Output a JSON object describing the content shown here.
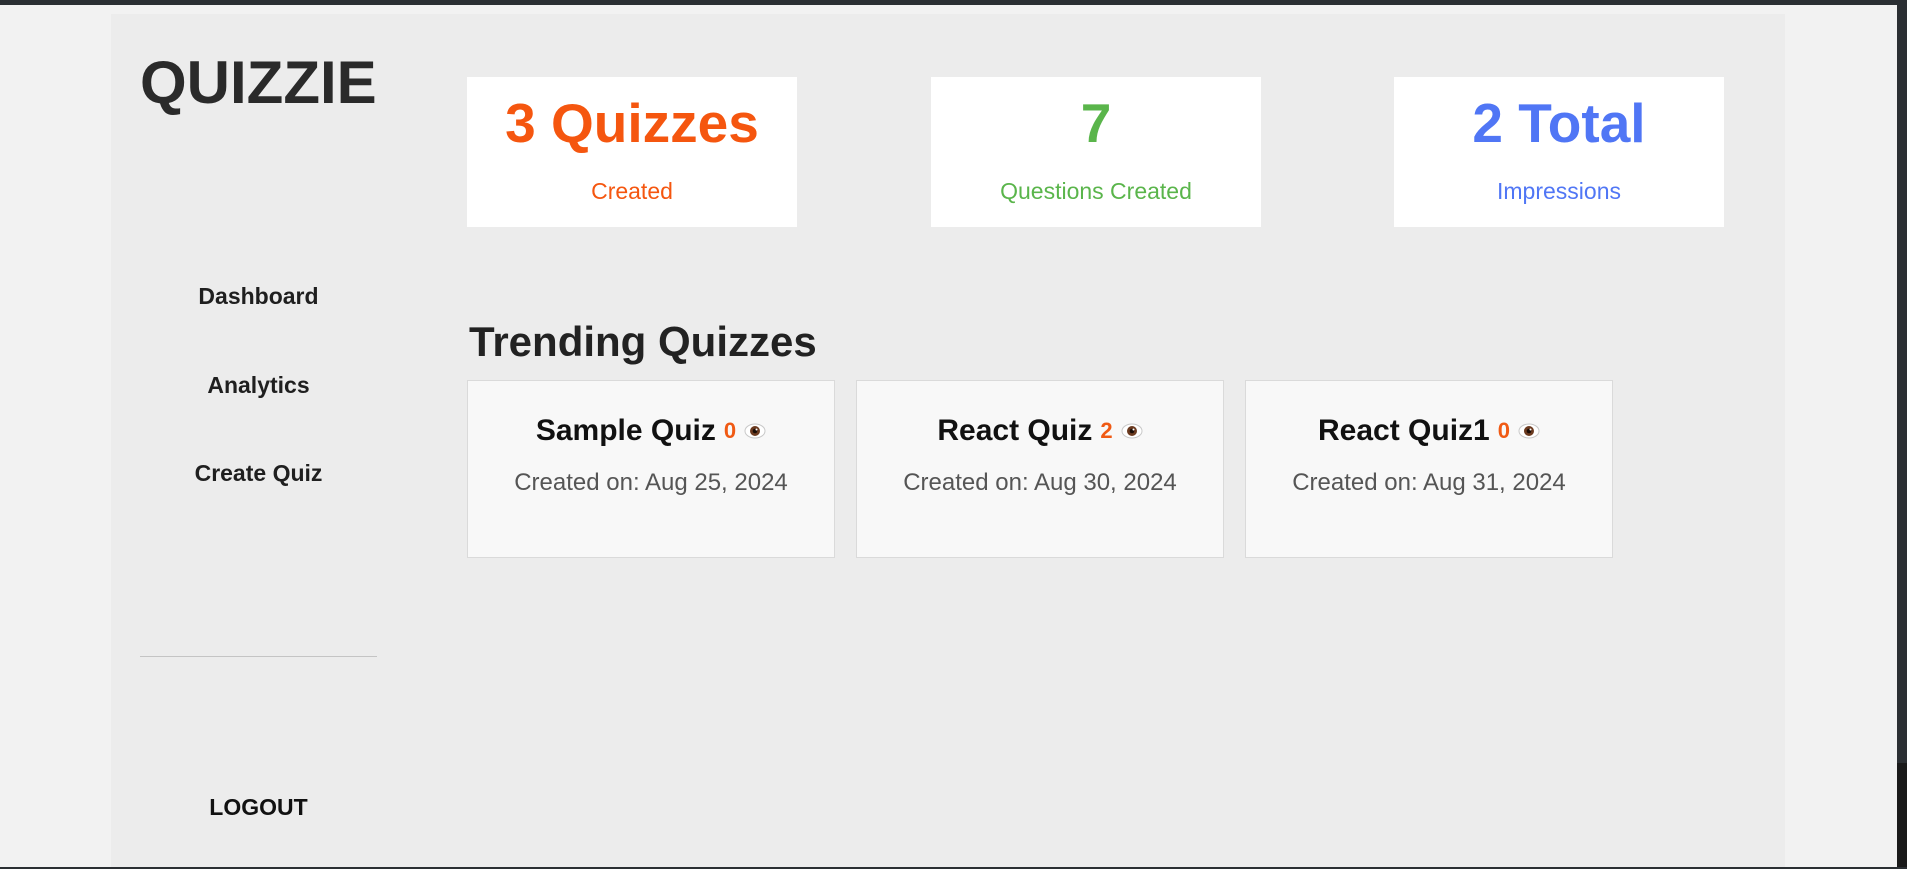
{
  "app": {
    "logo": "QUIZZIE"
  },
  "sidebar": {
    "items": [
      {
        "label": "Dashboard"
      },
      {
        "label": "Analytics"
      },
      {
        "label": "Create Quiz"
      }
    ],
    "logout": "LOGOUT"
  },
  "stats": [
    {
      "value": "3 Quizzes",
      "label": "Created",
      "color": "#f5560f"
    },
    {
      "value": "7",
      "label": "Questions Created",
      "color": "#5ab54b"
    },
    {
      "value": "2 Total",
      "label": "Impressions",
      "color": "#5076f5"
    }
  ],
  "trending": {
    "title": "Trending Quizzes",
    "quizzes": [
      {
        "name": "Sample Quiz",
        "views": "0",
        "icon": "eye-icon",
        "created": "Created on: Aug 25, 2024"
      },
      {
        "name": "React Quiz",
        "views": "2",
        "icon": "eye-icon",
        "created": "Created on: Aug 30, 2024"
      },
      {
        "name": "React Quiz1",
        "views": "0",
        "icon": "eye-icon",
        "created": "Created on: Aug 31, 2024"
      }
    ]
  }
}
